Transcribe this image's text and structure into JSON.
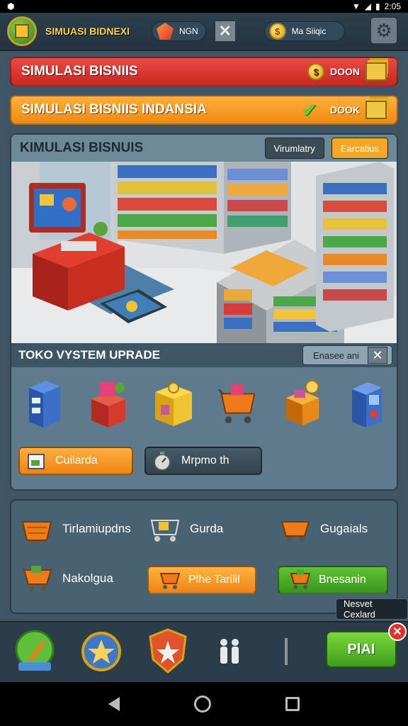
{
  "status_bar": {
    "time": "2:05"
  },
  "header": {
    "title": "SIMUASI BIDNEXI",
    "resource_gems": "NGN",
    "resource_coins": "Ma Siiqic"
  },
  "banners": [
    {
      "label": "SIMULASI BISNIIS",
      "value": "DOON",
      "color": "#d9342c"
    },
    {
      "label": "SIMULASI BISNIIS INDANSIA",
      "value": "DOOK",
      "color": "#f39a1e"
    }
  ],
  "panel": {
    "title": "KIMULASI BISNUIS",
    "tabs": [
      "Virumlatry",
      "Earcatius"
    ],
    "upgrade_title": "TOKO VYSTEM UPRADE",
    "upgrade_search": "Enasee ani",
    "upgrade_items": [
      "blue-cabinet",
      "red-stall",
      "yellow-box",
      "shopping-cart",
      "treasure-box",
      "atm-machine"
    ],
    "buttons": [
      {
        "label": "Cuilarda"
      },
      {
        "label": "Mrpmo th"
      }
    ]
  },
  "shop_panel": {
    "items": [
      {
        "label": "Tirlamiupdns"
      },
      {
        "label": "Gurda"
      },
      {
        "label": "Gugaials"
      },
      {
        "label": "Nakolgua"
      }
    ],
    "buttons": [
      {
        "label": "Plhe Tarilil"
      },
      {
        "label": "Bnesanin"
      }
    ]
  },
  "tooltip": "Nesvet Cexlard",
  "play_button": "PlAI",
  "colors": {
    "accent_orange": "#f5a623",
    "accent_green": "#4caf28",
    "accent_red": "#d9342c",
    "panel": "#5f7a8c"
  }
}
